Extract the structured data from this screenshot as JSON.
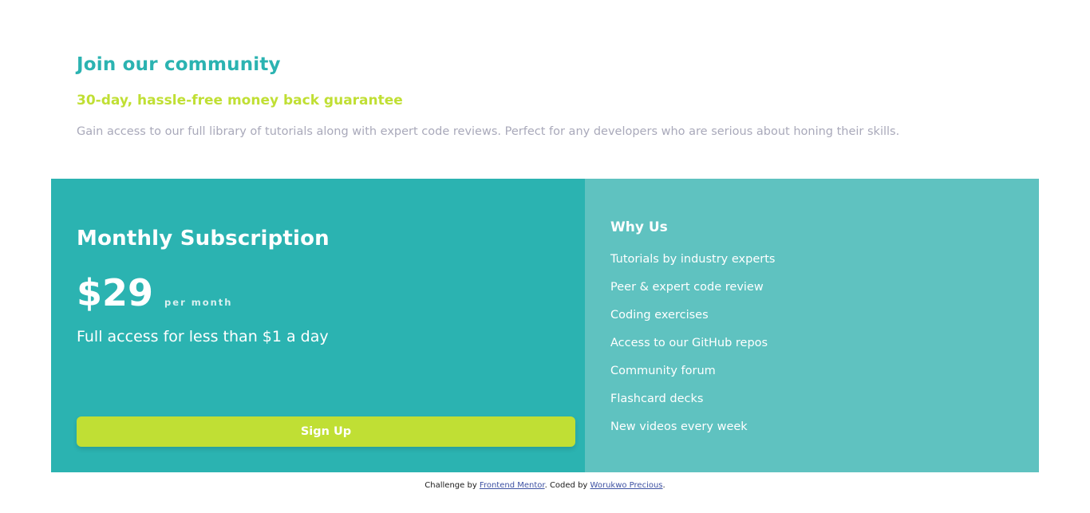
{
  "community": {
    "title": "Join our community",
    "subtitle": "30-day, hassle-free money back guarantee",
    "description": "Gain access to our full library of tutorials along with expert code reviews. Perfect for any developers who are serious about honing their skills."
  },
  "monthly": {
    "heading": "Monthly Subscription",
    "price": "$29",
    "per": "per month",
    "access": "Full access for less than $1 a day",
    "button_label": "Sign Up"
  },
  "why": {
    "heading": "Why Us",
    "items": [
      "Tutorials by industry experts",
      "Peer & expert code review",
      "Coding exercises",
      "Access to our GitHub repos",
      "Community forum",
      "Flashcard decks",
      "New videos every week"
    ]
  },
  "attribution": {
    "prefix": "Challenge by ",
    "link1": "Frontend Mentor",
    "middle": ". Coded by ",
    "link2": "Worukwo Precious",
    "suffix": "."
  },
  "colors": {
    "primary_teal": "#2bb3b1",
    "light_teal": "#5fc2c0",
    "accent_lime": "#c0df34",
    "gray_text": "#a9a9ba"
  }
}
